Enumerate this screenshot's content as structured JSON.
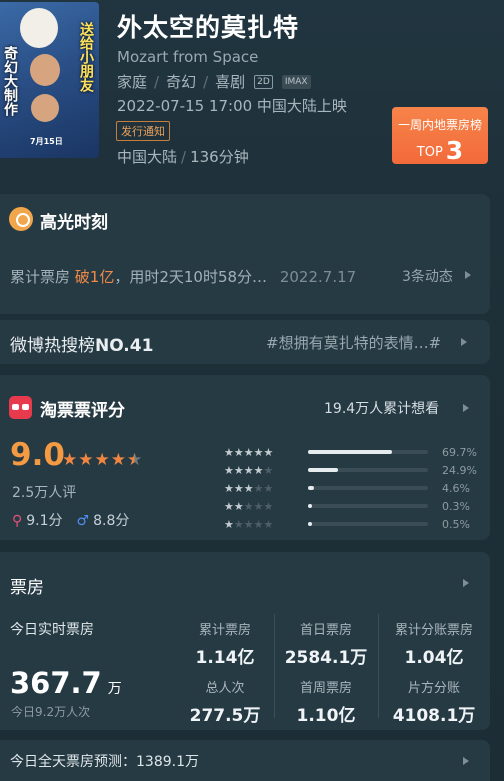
{
  "movie": {
    "title": "外太空的莫扎特",
    "subtitle": "Mozart from Space",
    "genres": [
      "家庭",
      "奇幻",
      "喜剧"
    ],
    "formats": [
      "2D",
      "IMAX"
    ],
    "release": "2022-07-15 17:00 中国大陆上映",
    "notice": "发行通知",
    "region": "中国大陆",
    "duration": "136分钟",
    "poster": {
      "left_text": "奇幻大制作",
      "right_text": "送给小朋友",
      "title_text": "外太空的莫扎特",
      "date_text": "7月15日"
    }
  },
  "rank_badge": {
    "line1": "一周内地票房榜",
    "prefix": "TOP",
    "number": "3"
  },
  "highlight": {
    "title": "高光时刻",
    "label": "累计票房",
    "emph": "破1亿",
    "rest": "，用时2天10时58分…",
    "date": "2022.7.17",
    "more": "3条动态"
  },
  "weibo": {
    "label": "微博热搜榜",
    "rank": "NO.41",
    "tag": "#想拥有莫扎特的表情…#"
  },
  "rating": {
    "title": "淘票票评分",
    "want": "19.4万人累计想看",
    "score": "9.0",
    "stars": 4.5,
    "raters": "2.5万人评",
    "female_score": "9.1分",
    "male_score": "8.8分",
    "distribution": [
      {
        "stars": 5,
        "pct": "69.7%",
        "value": 69.7
      },
      {
        "stars": 4,
        "pct": "24.9%",
        "value": 24.9
      },
      {
        "stars": 3,
        "pct": "4.6%",
        "value": 4.6
      },
      {
        "stars": 2,
        "pct": "0.3%",
        "value": 0.3
      },
      {
        "stars": 1,
        "pct": "0.5%",
        "value": 0.5
      }
    ]
  },
  "box_office": {
    "title": "票房",
    "today_label": "今日实时票房",
    "today_value": "367.7",
    "today_unit": "万",
    "today_people": "今日9.2万人次",
    "cells": [
      {
        "label": "累计票房",
        "value": "1.14亿"
      },
      {
        "label": "首日票房",
        "value": "2584.1万"
      },
      {
        "label": "累计分账票房",
        "value": "1.04亿"
      },
      {
        "label": "总人次",
        "value": "277.5万"
      },
      {
        "label": "首周票房",
        "value": "1.10亿"
      },
      {
        "label": "片方分账",
        "value": "4108.1万"
      }
    ],
    "prediction": "今日全天票房预测：1389.1万"
  }
}
